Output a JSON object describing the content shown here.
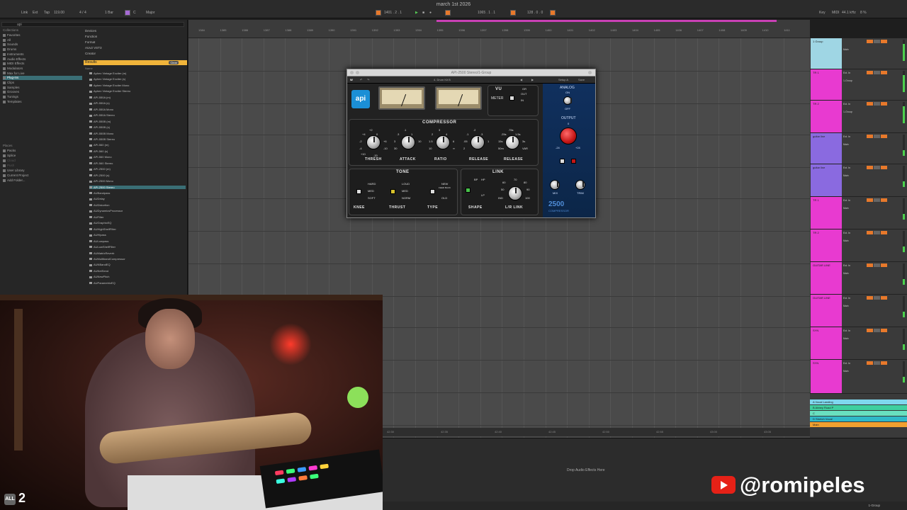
{
  "window": {
    "title": "march 1st 2026"
  },
  "topbar": {
    "link": "Link",
    "ext": "Ext",
    "tap": "Tap",
    "tempo": "119.00",
    "signature": "4 / 4",
    "quantize": "1 Bar",
    "scale_key": "C",
    "scale": "Major",
    "position": "1401 . 2 . 1",
    "end": "1065 . 1 . 1",
    "loop_len": "128 . 0 . 0",
    "key_label": "Key",
    "midi_label": "MIDI",
    "sample_rate": "44.1 kHz",
    "cpu": "8 %"
  },
  "browser": {
    "search_value": "api",
    "collections_header": "Collections",
    "categories": [
      "Favorites",
      "All",
      "Sounds",
      "Drums",
      "Instruments",
      "Audio Effects",
      "MIDI Effects",
      "Modulators",
      "Max for Live",
      "Plug-ins",
      "Clips",
      "Samples",
      "Grooves",
      "Tunings",
      "Templates"
    ],
    "places_header": "Places",
    "places": [
      "Packs",
      "Splice",
      "Cloud",
      "Push",
      "User Library",
      "Current Project",
      "Add Folder..."
    ],
    "filters": [
      "Devices",
      "Function",
      "Format",
      "AUv2  VST3",
      "Creator"
    ],
    "results_label": "Results",
    "clear_label": "Clear",
    "name_header": "Name",
    "results": [
      "Aphex Vintage Exciter (m)",
      "Aphex Vintage Exciter (s)",
      "Aphex Vintage Exciter Mono",
      "Aphex Vintage Exciter Stereo",
      "API-550A (m)",
      "API-550A (s)",
      "API-550A Mono",
      "API-550A Stereo",
      "API-550B (m)",
      "API-550B (s)",
      "API-550B Mono",
      "API-550B Stereo",
      "API-560 (m)",
      "API-560 (s)",
      "API-560 Mono",
      "API-560 Stereo",
      "API-2500 (m)",
      "API-2500 (s)",
      "API-2500 Mono",
      "API-2500 Stereo",
      "AUBandpass",
      "AUDelay",
      "AUDistortion",
      "AUDynamicsProcessor",
      "AUFilter",
      "AUGraphicEQ",
      "AUHighShelfFilter",
      "AUHipass",
      "AULowpass",
      "AULowShelfFilter",
      "AUMatrixReverb",
      "AUMultibandCompressor",
      "AUNBandEQ",
      "AUNetSend",
      "AUNewPitch",
      "AUParametricEQ"
    ],
    "selected_result": 19
  },
  "ruler": {
    "ticks": [
      "1384",
      "1385",
      "1386",
      "1387",
      "1388",
      "1389",
      "1390",
      "1391",
      "1392",
      "1393",
      "1394",
      "1395",
      "1396",
      "1397",
      "1398",
      "1399",
      "1400",
      "1401",
      "1402",
      "1403",
      "1404",
      "1405",
      "1406",
      "1407",
      "1408",
      "1409",
      "1410",
      "1411"
    ]
  },
  "timeline_bottom": [
    "42:30",
    "42:35",
    "42:40",
    "42:45",
    "42:50",
    "42:55",
    "43:00",
    "43:05",
    "43:10"
  ],
  "tracks": [
    {
      "name": "1 Group",
      "color": "#9fd6e4",
      "input": "",
      "route": "Main"
    },
    {
      "name": "TR 1",
      "color": "#e83ad0",
      "input": "Ext. In",
      "route": "1-Group"
    },
    {
      "name": "TR 2",
      "color": "#e83ad0",
      "input": "Ext. In",
      "route": "1-Group"
    },
    {
      "name": "guitar line",
      "color": "#8a6ae0",
      "input": "Ext. In",
      "route": "Main"
    },
    {
      "name": "guitar line",
      "color": "#8a6ae0",
      "input": "Ext. In",
      "route": "Main"
    },
    {
      "name": "TR 1",
      "color": "#e83ad0",
      "input": "Ext. In",
      "route": "Main"
    },
    {
      "name": "TR 2",
      "color": "#e83ad0",
      "input": "Ext. In",
      "route": "Main"
    },
    {
      "name": "GUITAR LINE",
      "color": "#e83ad0",
      "input": "Ext. In",
      "route": "Main"
    },
    {
      "name": "GUITAR LINE",
      "color": "#e83ad0",
      "input": "Ext. In",
      "route": "Main"
    },
    {
      "name": "SYN",
      "color": "#e83ad0",
      "input": "Ext. In",
      "route": "Main"
    },
    {
      "name": "SYN",
      "color": "#e83ad0",
      "input": "Ext. In",
      "route": "Main"
    }
  ],
  "return_tracks": [
    {
      "name": "A Vocal Landing",
      "color": "#7fd7ee"
    },
    {
      "name": "B Abbey Road P",
      "color": "#3fcfa0"
    },
    {
      "name": "C",
      "color": "#69e0c0"
    },
    {
      "name": "D Stretch Vocal",
      "color": "#2fb8c8"
    },
    {
      "name": "Main",
      "color": "#f0a030"
    }
  ],
  "plugin": {
    "window_title": "API-2500 Stereo/1-Group",
    "preset": "4. Drum Kit B",
    "toolbar_right": [
      "Setup A",
      "Save"
    ],
    "vu_label": "VU",
    "vu_out": "OUT",
    "vu_in": "IN",
    "vu_gr": "GR",
    "meter_label": "METER",
    "compressor_label": "COMPRESSOR",
    "knobs": [
      {
        "name": "THRESH",
        "scale": [
          "+4",
          "+2",
          "0",
          "-2",
          "+6",
          "-4",
          "-10",
          "+10",
          "-20"
        ]
      },
      {
        "name": "ATTACK",
        "scale": [
          ".3",
          ".1",
          "1",
          "3",
          "10",
          "30"
        ]
      },
      {
        "name": "RATIO",
        "scale": [
          "2",
          "3",
          "4",
          "1.5",
          "6",
          "10",
          "∞"
        ]
      },
      {
        "name": "RELEASE",
        "scale": [
          ".1",
          ".2",
          ".3",
          ".05",
          "1",
          "2"
        ]
      },
      {
        "name": "RELEASE",
        "scale": [
          ".25s",
          ".75s",
          "1.5s",
          "15s",
          "3s",
          "50m",
          "VAR"
        ]
      }
    ],
    "tone_label": "TONE",
    "knee": {
      "label": "KNEE",
      "options": [
        "HARD",
        "MED",
        "SOFT"
      ]
    },
    "thrust": {
      "label": "THRUST",
      "options": [
        "LOUD",
        "MED",
        "NORM"
      ]
    },
    "type": {
      "label": "TYPE",
      "options": [
        "NEW",
        "FEED BACK",
        "OLD"
      ]
    },
    "link_label": "LINK",
    "shape": {
      "label": "SHAPE",
      "options": [
        "BP",
        "HP",
        "LP"
      ]
    },
    "lr_link": {
      "label": "L/R LINK",
      "scale": [
        "60",
        "70",
        "80",
        "90",
        "50",
        "100",
        "IND"
      ]
    },
    "analog": {
      "label": "ANALOG",
      "on": "ON",
      "off": "OFF"
    },
    "output": {
      "label": "OUTPUT",
      "scale": [
        "0",
        "-24",
        "+24"
      ]
    },
    "mix_label": "MIX",
    "trim_label": "TRIM",
    "brand": "api",
    "model": "2500",
    "model_sub": "COMPRESSOR"
  },
  "devices": {
    "drop_text": "Drop Audio Effects Here"
  },
  "status": {
    "group_label": "1-Group"
  },
  "overlay": {
    "badge": "ALL",
    "badge_num": "2",
    "handle": "@romipeles"
  }
}
